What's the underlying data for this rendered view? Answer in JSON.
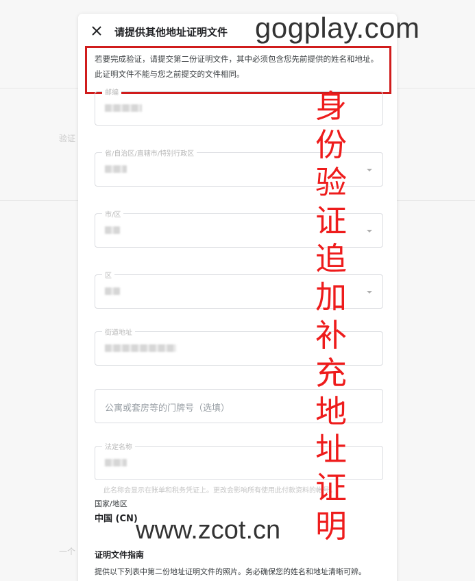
{
  "dialog": {
    "title": "请提供其他地址证明文件",
    "notice": "若要完成验证，请提交第二份证明文件，其中必须包含您先前提供的姓名和地址。此证明文件不能与您之前提交的文件相同。"
  },
  "background": {
    "left_fragment": "验证",
    "bottom_fragment": "一个"
  },
  "fields": {
    "postal_code": {
      "label": "邮编"
    },
    "province": {
      "label": "省/自治区/直辖市/特别行政区"
    },
    "city": {
      "label": "市/区"
    },
    "district": {
      "label": "区"
    },
    "street": {
      "label": "街道地址"
    },
    "apartment": {
      "placeholder": "公寓或套房等的门牌号（选填）"
    },
    "legal_name": {
      "label": "法定名称",
      "help": "此名称会显示在账单和税务凭证上。更改会影响所有使用此付款资料的帐号。"
    }
  },
  "country": {
    "label": "国家/地区",
    "value": "中国 (CN)"
  },
  "guide": {
    "title": "证明文件指南",
    "text": "提供以下列表中第二份地址证明文件的照片。务必确保您的姓名和地址清晰可辨。"
  },
  "overlay": {
    "watermark_top": "gogplay.com",
    "watermark_bottom": "www.zcot.cn",
    "caption": "身份验证追加补充地址证明",
    "caption_color": "#ee1c1c",
    "notice_border_color": "#d01c1c"
  }
}
